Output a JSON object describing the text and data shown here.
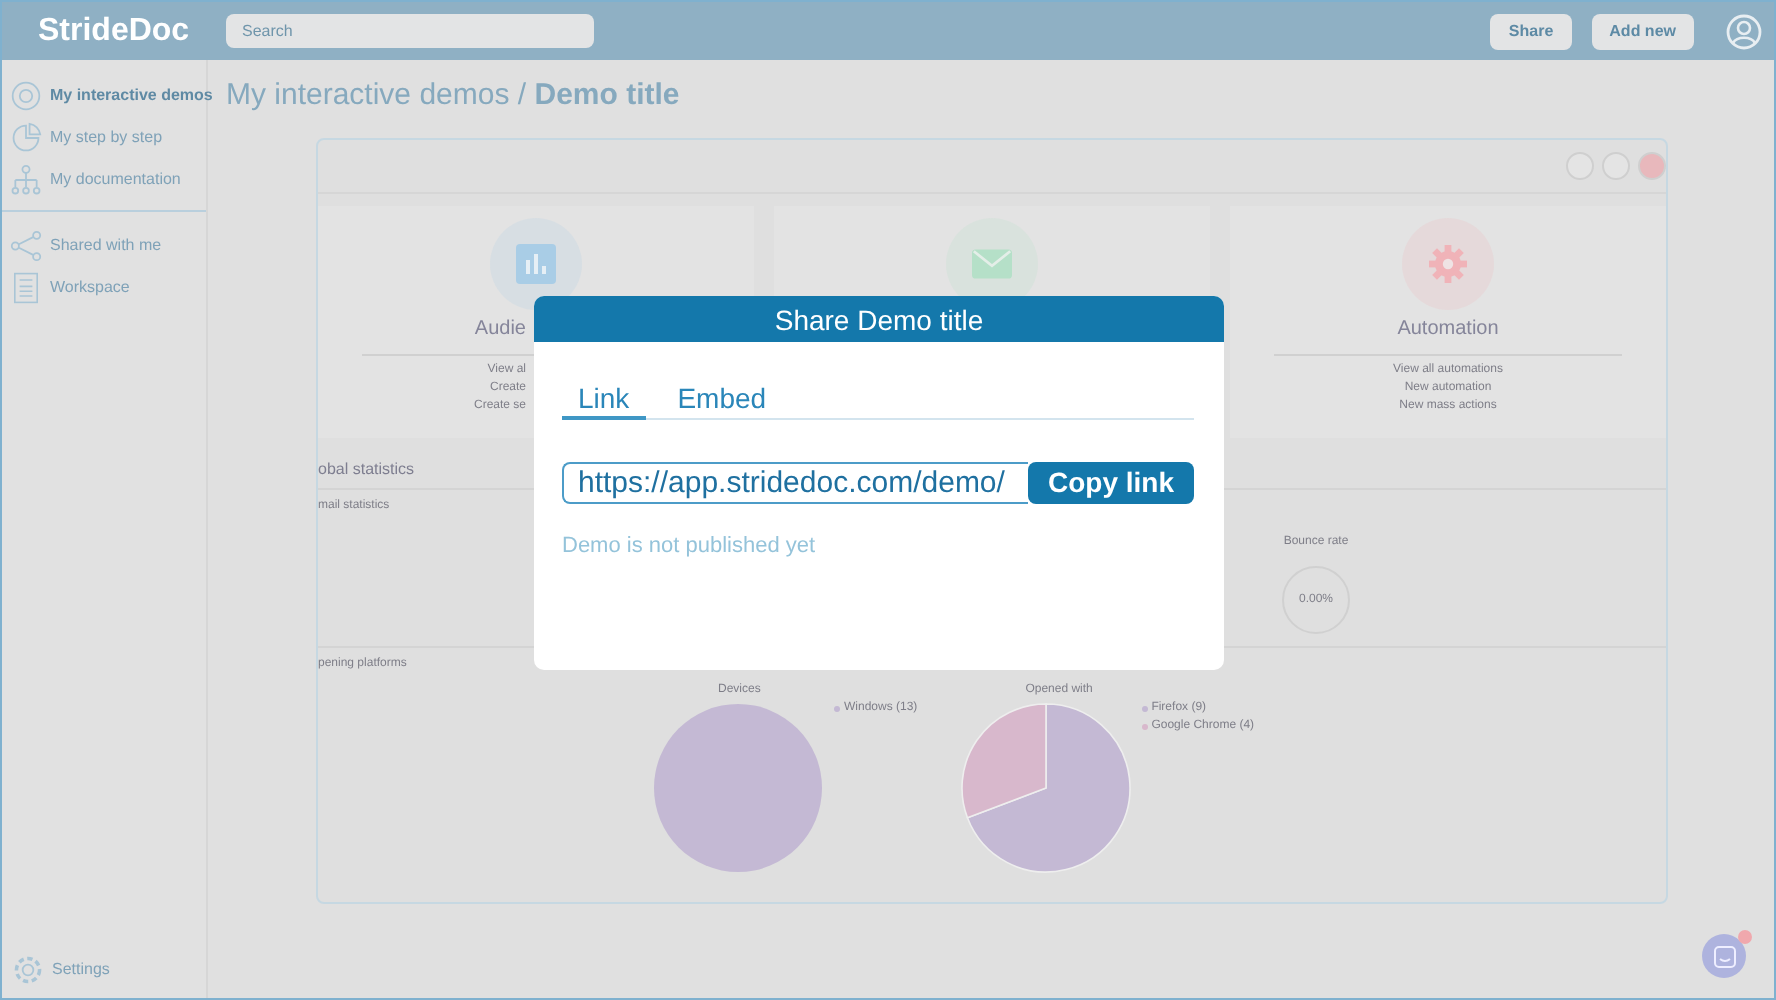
{
  "topbar": {
    "logo": "StrideDoc",
    "search": {
      "placeholder": "Search"
    },
    "buttons": [
      "Share",
      "Add new"
    ]
  },
  "sidebar": {
    "items": [
      {
        "label": "My interactive demos",
        "kind": "target",
        "selected": true
      },
      {
        "label": "My step by step",
        "kind": "pie",
        "selected": false
      },
      {
        "label": "My documentation",
        "kind": "tree",
        "selected": false
      }
    ],
    "shared_items": [
      {
        "label": "Shared with me",
        "kind": "share",
        "selected": false
      },
      {
        "label": "Workspace",
        "kind": "list",
        "selected": false
      }
    ],
    "settings": "Settings"
  },
  "breadcrumb": {
    "parent": "My interactive demos",
    "separator": "/",
    "current": "Demo title"
  },
  "preview": {
    "cards": [
      {
        "title": "Audie",
        "kind": "chart",
        "color": "#a9cde6",
        "links": [
          "View al",
          "Create",
          "Create se"
        ]
      },
      {
        "kind": "mail",
        "color": "#b5e0c8"
      },
      {
        "title": "Automation",
        "kind": "gear",
        "color": "#f0b3b8",
        "links": [
          "View all automations",
          "New automation",
          "New mass actions"
        ]
      }
    ],
    "global_title": "obal statistics",
    "email_title": "mail statistics",
    "bounce": {
      "label": "Bounce rate",
      "value": "0.00%"
    },
    "platforms_title": "pening platforms",
    "charts": [
      {
        "chart_data": {
          "type": "pie",
          "title": "Devices",
          "categories": [
            "Windows (13)"
          ],
          "values": [
            13
          ],
          "colors": [
            "#c4b9d4"
          ],
          "legend": "right"
        }
      },
      {
        "chart_data": {
          "type": "pie",
          "title": "Opened with",
          "categories": [
            "Firefox (9)",
            "Google Chrome (4)"
          ],
          "values": [
            9,
            4
          ],
          "colors": [
            "#c4b9d4",
            "#d8b8cc"
          ],
          "legend": "right"
        }
      }
    ]
  },
  "modal": {
    "title": "Share Demo title",
    "tabs": [
      {
        "label": "Link",
        "selected": true
      },
      {
        "label": "Embed",
        "selected": false
      }
    ],
    "url": "https://app.stridedoc.com/demo/",
    "copy_button": "Copy link",
    "note": "Demo is not published yet"
  }
}
